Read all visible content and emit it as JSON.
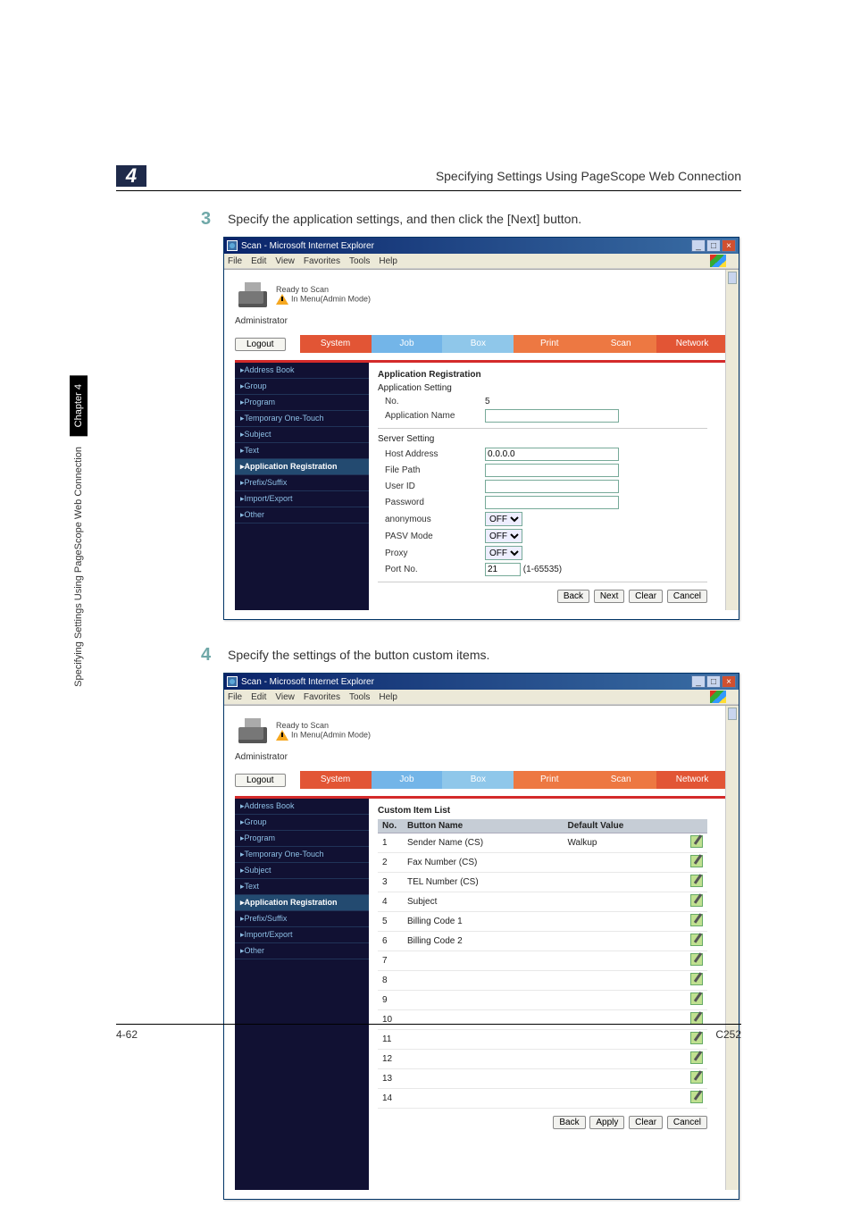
{
  "header": {
    "chapter_num": "4",
    "title": "Specifying Settings Using PageScope Web Connection"
  },
  "side_tab": {
    "black": "Chapter 4",
    "text": "Specifying Settings Using PageScope Web Connection"
  },
  "steps": {
    "s3": {
      "num": "3",
      "text": "Specify the application settings, and then click the [Next] button."
    },
    "s4": {
      "num": "4",
      "text": "Specify the settings of the button custom items."
    }
  },
  "ie": {
    "title": "Scan - Microsoft Internet Explorer",
    "menus": [
      "File",
      "Edit",
      "View",
      "Favorites",
      "Tools",
      "Help"
    ],
    "win_min": "_",
    "win_max": "□",
    "win_close": "×"
  },
  "app": {
    "status1": "Ready to Scan",
    "status2": "In Menu(Admin Mode)",
    "admin": "Administrator",
    "logout": "Logout",
    "tabs": {
      "system": "System",
      "job": "Job",
      "box": "Box",
      "print": "Print",
      "scan": "Scan",
      "network": "Network"
    },
    "sidebar": [
      "▸Address Book",
      "▸Group",
      "▸Program",
      "▸Temporary One-Touch",
      "▸Subject",
      "▸Text",
      "▸Application Registration",
      "▸Prefix/Suffix",
      "▸Import/Export",
      "▸Other"
    ],
    "sidebar_selected_index": 6
  },
  "panel1": {
    "h1": "Application Registration",
    "h2": "Application Setting",
    "no_label": "No.",
    "no_value": "5",
    "appname_label": "Application Name",
    "appname_value": "",
    "h3": "Server Setting",
    "host_label": "Host Address",
    "host_value": "0.0.0.0",
    "filepath_label": "File Path",
    "filepath_value": "",
    "userid_label": "User ID",
    "userid_value": "",
    "password_label": "Password",
    "password_value": "",
    "anon_label": "anonymous",
    "pasv_label": "PASV Mode",
    "proxy_label": "Proxy",
    "select_off": "OFF",
    "port_label": "Port No.",
    "port_value": "21",
    "port_range": "(1-65535)",
    "buttons": {
      "back": "Back",
      "next": "Next",
      "clear": "Clear",
      "cancel": "Cancel"
    }
  },
  "panel2": {
    "h1": "Custom Item List",
    "cols": {
      "no": "No.",
      "name": "Button Name",
      "def": "Default Value"
    },
    "rows": [
      {
        "no": "1",
        "name": "Sender Name (CS)",
        "def": "Walkup"
      },
      {
        "no": "2",
        "name": "Fax Number (CS)",
        "def": ""
      },
      {
        "no": "3",
        "name": "TEL Number (CS)",
        "def": ""
      },
      {
        "no": "4",
        "name": "Subject",
        "def": ""
      },
      {
        "no": "5",
        "name": "Billing Code 1",
        "def": ""
      },
      {
        "no": "6",
        "name": "Billing Code 2",
        "def": ""
      },
      {
        "no": "7",
        "name": "",
        "def": ""
      },
      {
        "no": "8",
        "name": "",
        "def": ""
      },
      {
        "no": "9",
        "name": "",
        "def": ""
      },
      {
        "no": "10",
        "name": "",
        "def": ""
      },
      {
        "no": "11",
        "name": "",
        "def": ""
      },
      {
        "no": "12",
        "name": "",
        "def": ""
      },
      {
        "no": "13",
        "name": "",
        "def": ""
      },
      {
        "no": "14",
        "name": "",
        "def": ""
      }
    ],
    "buttons": {
      "back": "Back",
      "apply": "Apply",
      "clear": "Clear",
      "cancel": "Cancel"
    }
  },
  "footer": {
    "left": "4-62",
    "right": "C252"
  }
}
